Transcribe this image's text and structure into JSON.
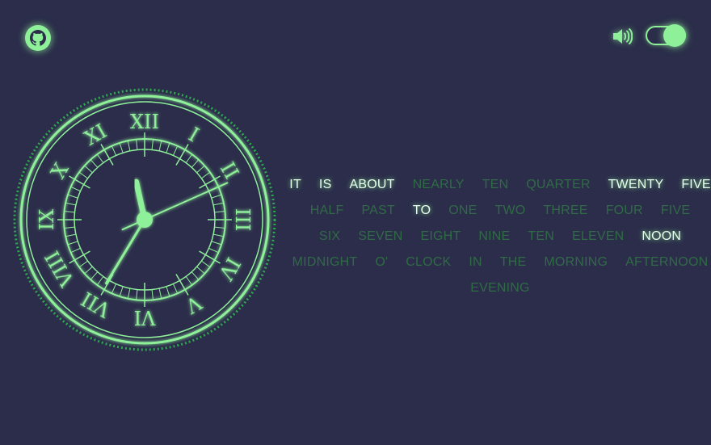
{
  "header": {
    "github_icon": "github-icon",
    "speaker_icon": "speaker-icon",
    "sound_toggle_on": true
  },
  "clock": {
    "numerals": [
      "XII",
      "I",
      "II",
      "III",
      "IV",
      "V",
      "VI",
      "VII",
      "VIII",
      "IX",
      "X",
      "XI"
    ],
    "time": {
      "hour": 11,
      "minute": 35,
      "second": 11
    },
    "accent_color": "#8ff09a",
    "background_color": "#2b2d4a"
  },
  "word_clock": {
    "rows": [
      [
        {
          "text": "IT",
          "on": true
        },
        {
          "text": "IS",
          "on": true
        },
        {
          "text": "ABOUT",
          "on": true
        },
        {
          "text": "NEARLY",
          "on": false
        },
        {
          "text": "TEN",
          "on": false
        },
        {
          "text": "QUARTER",
          "on": false
        },
        {
          "text": "TWENTY",
          "on": true
        },
        {
          "text": "FIVE",
          "on": true
        }
      ],
      [
        {
          "text": "HALF",
          "on": false
        },
        {
          "text": "PAST",
          "on": false
        },
        {
          "text": "TO",
          "on": true
        },
        {
          "text": "ONE",
          "on": false
        },
        {
          "text": "TWO",
          "on": false
        },
        {
          "text": "THREE",
          "on": false
        },
        {
          "text": "FOUR",
          "on": false
        },
        {
          "text": "FIVE",
          "on": false
        }
      ],
      [
        {
          "text": "SIX",
          "on": false
        },
        {
          "text": "SEVEN",
          "on": false
        },
        {
          "text": "EIGHT",
          "on": false
        },
        {
          "text": "NINE",
          "on": false
        },
        {
          "text": "TEN",
          "on": false
        },
        {
          "text": "ELEVEN",
          "on": false
        },
        {
          "text": "NOON",
          "on": true
        }
      ],
      [
        {
          "text": "MIDNIGHT",
          "on": false
        },
        {
          "text": "O'",
          "on": false
        },
        {
          "text": "CLOCK",
          "on": false
        },
        {
          "text": "IN",
          "on": false
        },
        {
          "text": "THE",
          "on": false
        },
        {
          "text": "MORNING",
          "on": false
        },
        {
          "text": "AFTERNOON",
          "on": false
        }
      ],
      [
        {
          "text": "EVENING",
          "on": false
        }
      ]
    ]
  }
}
